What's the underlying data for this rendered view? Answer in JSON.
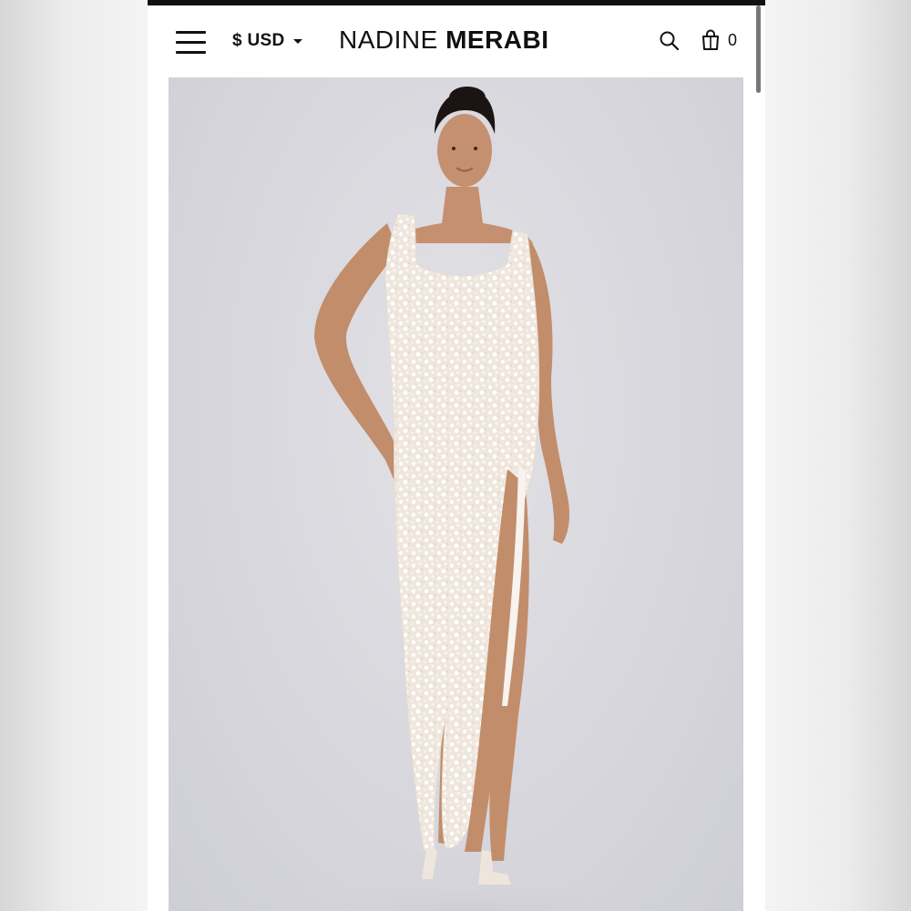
{
  "header": {
    "menu_icon": "hamburger-menu-icon",
    "currency": "$ USD",
    "currency_icon": "caret-down-icon",
    "logo_first": "NADINE",
    "logo_second": "MERABI",
    "search_icon": "search-icon",
    "cart_icon": "shopping-bag-icon",
    "cart_count": "0"
  },
  "hero": {
    "image": "model-in-sequin-maxi-dress-photo"
  },
  "colors": {
    "text": "#111111",
    "hero_bg": "#d6d6dc",
    "dress": "#f3eee9"
  }
}
